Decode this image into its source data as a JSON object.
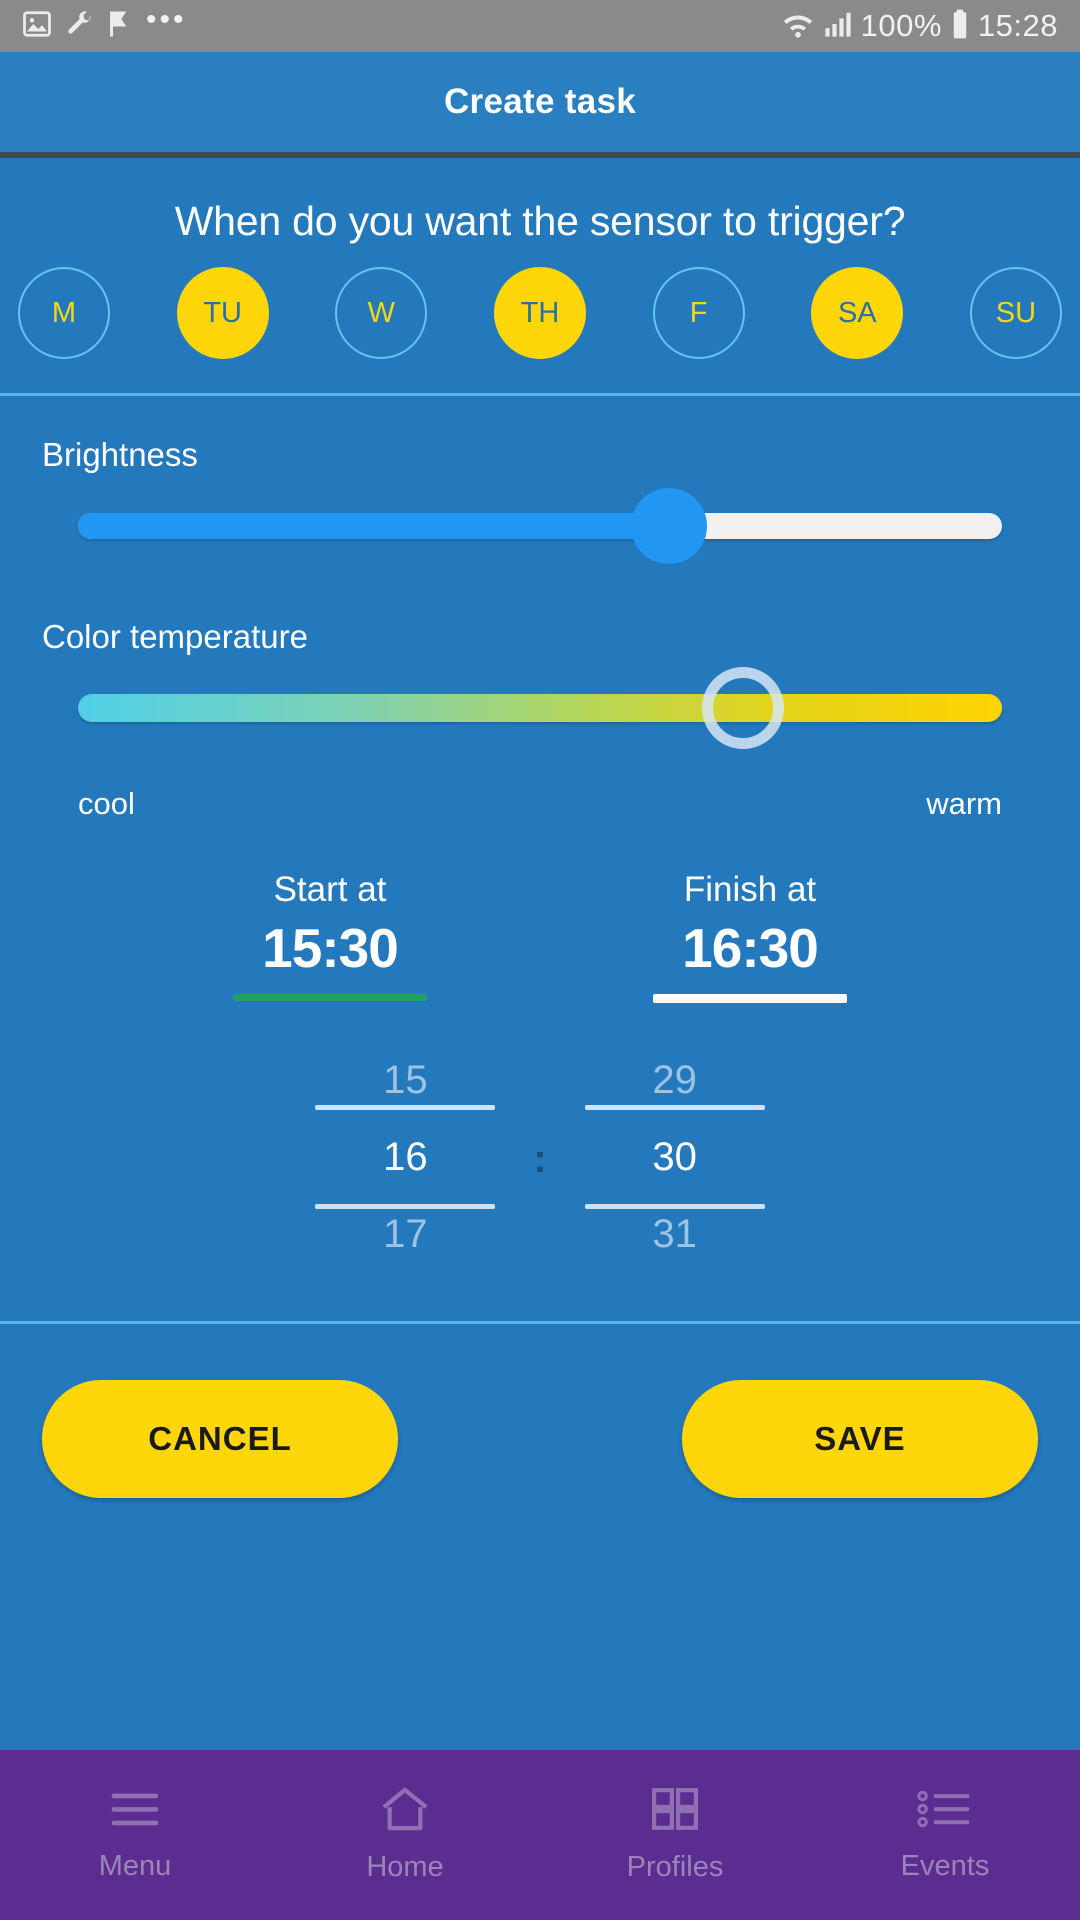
{
  "statusbar": {
    "left_icons": [
      "image-icon",
      "wrench-icon",
      "flag-icon",
      "overflow-dots-icon"
    ],
    "dots": "•••",
    "right_icons": [
      "wifi-icon",
      "cell-signal-icon",
      "battery-icon"
    ],
    "battery_text": "100%",
    "clock": "15:28"
  },
  "appbar": {
    "title": "Create task"
  },
  "main": {
    "question": "When do you want the sensor to trigger?",
    "days": [
      {
        "label": "M",
        "selected": false
      },
      {
        "label": "TU",
        "selected": true
      },
      {
        "label": "W",
        "selected": false
      },
      {
        "label": "TH",
        "selected": true
      },
      {
        "label": "F",
        "selected": false
      },
      {
        "label": "SA",
        "selected": true
      },
      {
        "label": "SU",
        "selected": false
      }
    ],
    "brightness": {
      "label": "Brightness",
      "value_pct": 64
    },
    "color_temperature": {
      "label": "Color temperature",
      "value_pct": 72,
      "cool_label": "cool",
      "warm_label": "warm",
      "gradient_from": "#4fd0e7",
      "gradient_to": "#ffd400"
    },
    "start": {
      "label": "Start at",
      "value": "15:30",
      "underline_color": "#1fa06a",
      "active": false
    },
    "finish": {
      "label": "Finish at",
      "value": "16:30",
      "underline_color": "#ffffff",
      "active": true
    },
    "picker": {
      "hour": {
        "prev": "15",
        "current": "16",
        "next": "17"
      },
      "separator": ":",
      "minute": {
        "prev": "29",
        "current": "30",
        "next": "31"
      }
    }
  },
  "actions": {
    "cancel": "CANCEL",
    "save": "SAVE"
  },
  "navbar": {
    "items": [
      {
        "label": "Menu",
        "icon": "menu-icon"
      },
      {
        "label": "Home",
        "icon": "home-icon"
      },
      {
        "label": "Profiles",
        "icon": "grid-icon"
      },
      {
        "label": "Events",
        "icon": "list-icon"
      }
    ]
  },
  "colors": {
    "background": "#2479bd",
    "appbar": "#2a7fc0",
    "accent_yellow": "#ffd60a",
    "slider_blue": "#2196f3",
    "navbar_purple": "#5b2d90",
    "divider": "#59b7e8"
  }
}
